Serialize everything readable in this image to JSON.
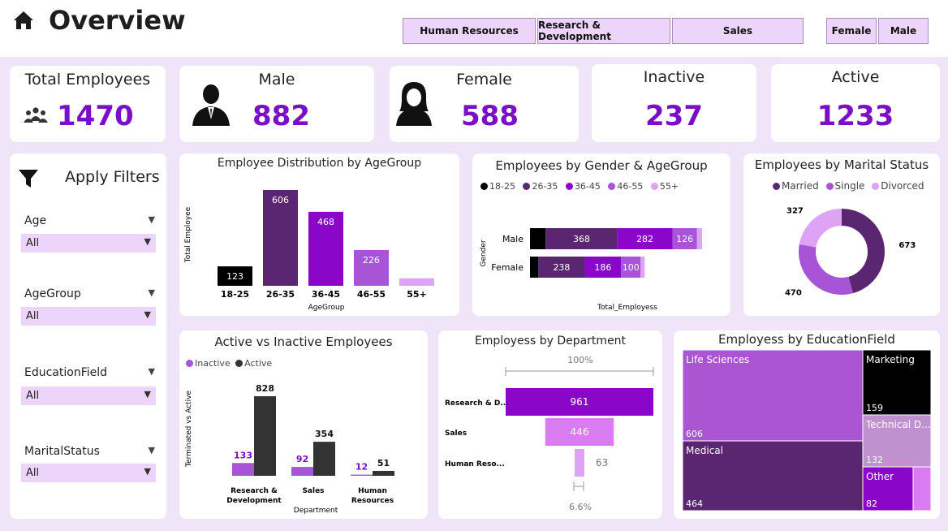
{
  "header": {
    "title": "Overview",
    "departments": [
      "Human Resources",
      "Research & Development",
      "Sales"
    ],
    "genders": [
      "Female",
      "Male"
    ]
  },
  "kpis": {
    "total": {
      "label": "Total Employees",
      "value": "1470"
    },
    "male": {
      "label": "Male",
      "value": "882"
    },
    "female": {
      "label": "Female",
      "value": "588"
    },
    "inactive": {
      "label": "Inactive",
      "value": "237"
    },
    "active": {
      "label": "Active",
      "value": "1233"
    }
  },
  "filters": {
    "title": "Apply Filters",
    "items": [
      {
        "label": "Age",
        "value": "All"
      },
      {
        "label": "AgeGroup",
        "value": "All"
      },
      {
        "label": "EducationField",
        "value": "All"
      },
      {
        "label": "MaritalStatus",
        "value": "All"
      }
    ]
  },
  "colors": {
    "accent": "#7a0fc7",
    "black": "#000000",
    "dark": "#5b2671",
    "purple": "#8a07c9",
    "mid": "#a755d6",
    "light": "#dfa3f6"
  },
  "chart_data": [
    {
      "id": "age_dist",
      "type": "bar",
      "title": "Employee Distribution by AgeGroup",
      "xlabel": "AgeGroup",
      "ylabel": "Total Employee",
      "categories": [
        "18-25",
        "26-35",
        "36-45",
        "46-55",
        "55+"
      ],
      "values": [
        123,
        606,
        468,
        226,
        47
      ],
      "labels": [
        "123",
        "606",
        "468",
        "226",
        ""
      ]
    },
    {
      "id": "gender_age",
      "type": "bar",
      "orientation": "horizontal-stacked",
      "title": "Employees by Gender & AgeGroup",
      "xlabel": "Total_Employess",
      "ylabel": "Gender",
      "categories": [
        "Male",
        "Female"
      ],
      "series": [
        {
          "name": "18-25",
          "values": [
            80,
            43
          ]
        },
        {
          "name": "26-35",
          "values": [
            368,
            238
          ]
        },
        {
          "name": "36-45",
          "values": [
            282,
            186
          ]
        },
        {
          "name": "46-55",
          "values": [
            126,
            100
          ]
        },
        {
          "name": "55+",
          "values": [
            26,
            21
          ]
        }
      ]
    },
    {
      "id": "marital",
      "type": "pie",
      "donut": true,
      "title": "Employees by Marital Status",
      "categories": [
        "Married",
        "Single",
        "Divorced"
      ],
      "values": [
        673,
        470,
        327
      ]
    },
    {
      "id": "active_inactive",
      "type": "bar",
      "title": "Active vs Inactive Employees",
      "xlabel": "Department",
      "ylabel": "Terminated vs Active",
      "categories": [
        "Research & Development",
        "Sales",
        "Human Resources"
      ],
      "series": [
        {
          "name": "Inactive",
          "values": [
            133,
            92,
            12
          ]
        },
        {
          "name": "Active",
          "values": [
            828,
            354,
            51
          ]
        }
      ]
    },
    {
      "id": "department_funnel",
      "type": "bar",
      "orientation": "funnel",
      "title": "Employess by Department",
      "categories": [
        "Research & D...",
        "Sales",
        "Human Reso..."
      ],
      "values": [
        961,
        446,
        63
      ],
      "top_percent": "100%",
      "bottom_percent": "6.6%"
    },
    {
      "id": "education",
      "type": "heatmap",
      "subtype": "treemap",
      "title": "Employess by EducationField",
      "categories": [
        "Life Sciences",
        "Medical",
        "Marketing",
        "Technical D...",
        "Other",
        ""
      ],
      "values": [
        606,
        464,
        159,
        132,
        82,
        27
      ]
    }
  ]
}
